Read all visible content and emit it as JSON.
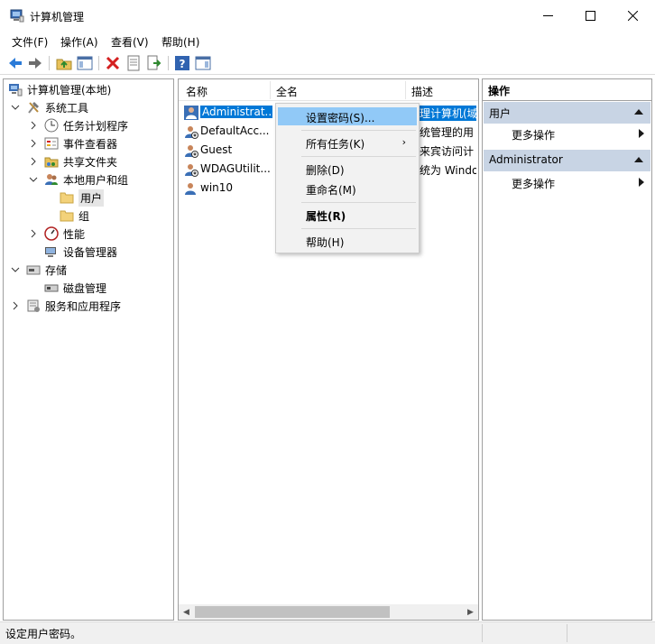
{
  "window": {
    "title": "计算机管理"
  },
  "menu": [
    "文件(F)",
    "操作(A)",
    "查看(V)",
    "帮助(H)"
  ],
  "tree": {
    "root": "计算机管理(本地)",
    "system_tools": "系统工具",
    "task_scheduler": "任务计划程序",
    "event_viewer": "事件查看器",
    "shared_folders": "共享文件夹",
    "local_users_groups": "本地用户和组",
    "users": "用户",
    "groups": "组",
    "performance": "性能",
    "device_manager": "设备管理器",
    "storage": "存储",
    "disk_management": "磁盘管理",
    "services_apps": "服务和应用程序"
  },
  "list": {
    "columns": [
      "名称",
      "全名",
      "描述"
    ],
    "rows": [
      {
        "name": "Administrat...",
        "desc": "理计算机(域"
      },
      {
        "name": "DefaultAcc...",
        "desc": "统管理的用"
      },
      {
        "name": "Guest",
        "desc": "来宾访问计"
      },
      {
        "name": "WDAGUtilit...",
        "desc": "统为 Windo"
      },
      {
        "name": "win10",
        "desc": ""
      }
    ]
  },
  "context_menu": {
    "set_password": "设置密码(S)...",
    "all_tasks": "所有任务(K)",
    "delete": "删除(D)",
    "rename": "重命名(M)",
    "properties": "属性(R)",
    "help": "帮助(H)"
  },
  "actions": {
    "title": "操作",
    "section1": "用户",
    "more1": "更多操作",
    "section2": "Administrator",
    "more2": "更多操作"
  },
  "status": "设定用户密码。",
  "colors": {
    "selection": "#0078d7",
    "menu_highlight": "#91c9f7",
    "action_header": "#c8d4e4"
  }
}
